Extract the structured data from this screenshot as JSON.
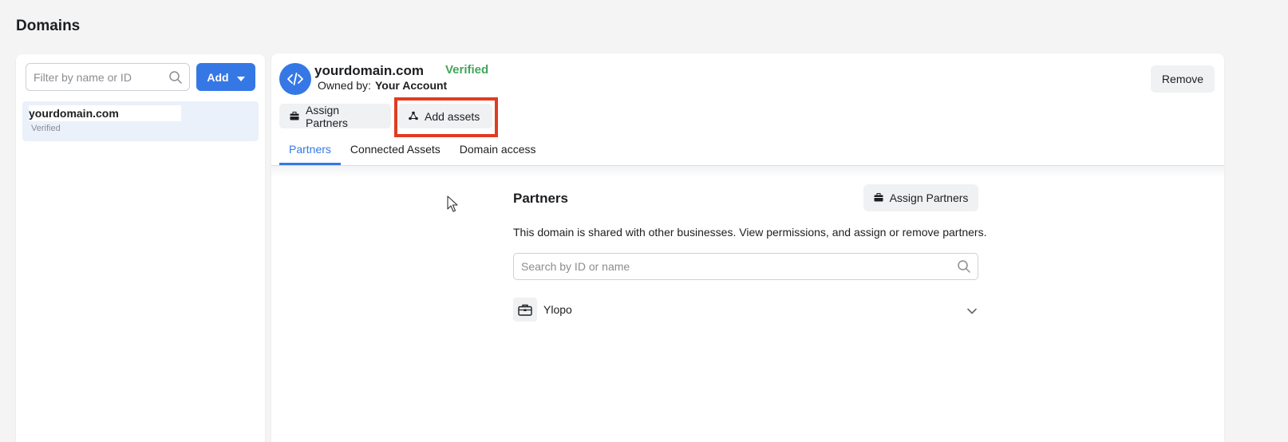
{
  "page": {
    "title": "Domains"
  },
  "sidebar": {
    "filter_placeholder": "Filter by name or ID",
    "add_label": "Add",
    "items": [
      {
        "name": "yourdomain.com",
        "status": "Verified"
      }
    ]
  },
  "detail": {
    "domain": "yourdomain.com",
    "status": "Verified",
    "status_color": "#42a55c",
    "owned_by_label": "Owned by:",
    "owned_by_value": "Your Account",
    "remove_label": "Remove",
    "actions": {
      "assign_partners": "Assign Partners",
      "add_assets": "Add assets"
    },
    "tabs": [
      {
        "label": "Partners",
        "active": true
      },
      {
        "label": "Connected Assets",
        "active": false
      },
      {
        "label": "Domain access",
        "active": false
      }
    ]
  },
  "partners_section": {
    "title": "Partners",
    "assign_button": "Assign Partners",
    "description": "This domain is shared with other businesses. View permissions, and assign or remove partners.",
    "search_placeholder": "Search by ID or name",
    "partners": [
      {
        "name": "Ylopo"
      }
    ]
  },
  "colors": {
    "accent": "#3578e5",
    "highlight": "#e03c22"
  }
}
